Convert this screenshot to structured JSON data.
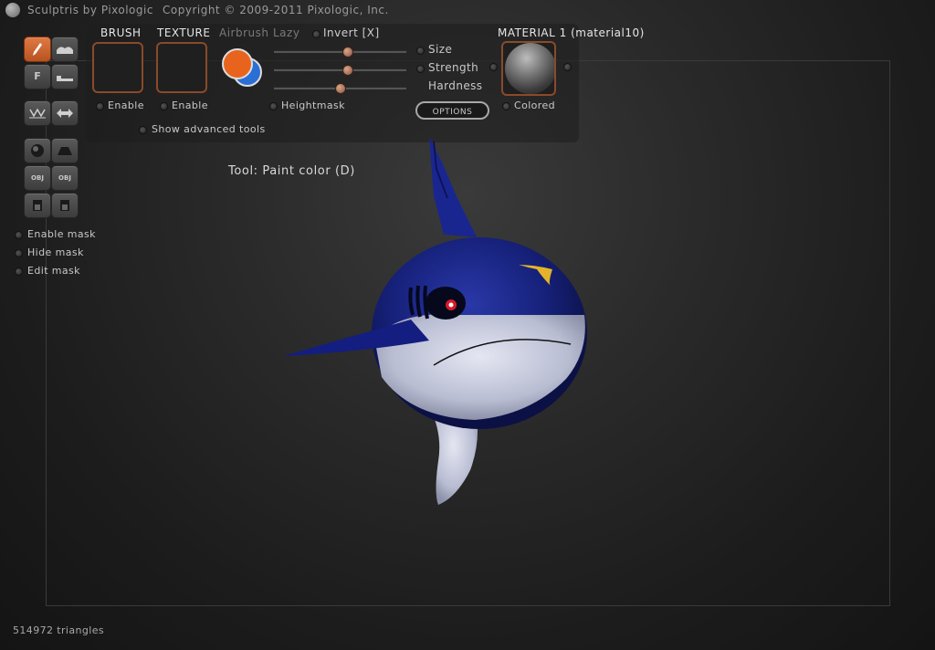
{
  "titlebar": {
    "app_title": "Sculptris by Pixologic",
    "copyright": "Copyright © 2009-2011 Pixologic, Inc."
  },
  "toolbar": {
    "brush_label": "BRUSH",
    "texture_label": "TEXTURE",
    "airbrush_label": "Airbrush",
    "lazy_label": "Lazy",
    "invert_label": "Invert [X]",
    "brush_enable_label": "Enable",
    "texture_enable_label": "Enable",
    "heightmask_label": "Heightmask",
    "show_advanced_label": "Show advanced tools",
    "size_label": "Size",
    "strength_label": "Strength",
    "hardness_label": "Hardness",
    "options_label": "OPTIONS",
    "material_label": "MATERIAL 1 (material10)",
    "colored_label": "Colored",
    "primary_color": "#e8641e",
    "secondary_color": "#2a6fd6",
    "sliders": {
      "size": 0.55,
      "strength": 0.55,
      "hardness": 0.5
    }
  },
  "left_tools": {
    "buttons": [
      {
        "name": "paint-brush-icon",
        "text": "",
        "active": true
      },
      {
        "name": "bump-icon",
        "text": ""
      },
      {
        "name": "flatten-icon",
        "text": "F"
      },
      {
        "name": "crease-icon",
        "text": ""
      },
      {
        "name": "symmetry-icon",
        "text": "⪳"
      },
      {
        "name": "mirror-icon",
        "text": "⇔"
      },
      {
        "name": "sphere-icon",
        "text": ""
      },
      {
        "name": "plane-icon",
        "text": ""
      },
      {
        "name": "import-obj-icon",
        "text": "OBJ"
      },
      {
        "name": "export-obj-icon",
        "text": "OBJ"
      },
      {
        "name": "open-file-icon",
        "text": ""
      },
      {
        "name": "save-file-icon",
        "text": ""
      }
    ],
    "mask": {
      "enable": "Enable mask",
      "hide": "Hide mask",
      "edit": "Edit mask"
    }
  },
  "viewport": {
    "tool_label": "Tool: Paint color (D)"
  },
  "status": {
    "triangles": "514972 triangles"
  }
}
